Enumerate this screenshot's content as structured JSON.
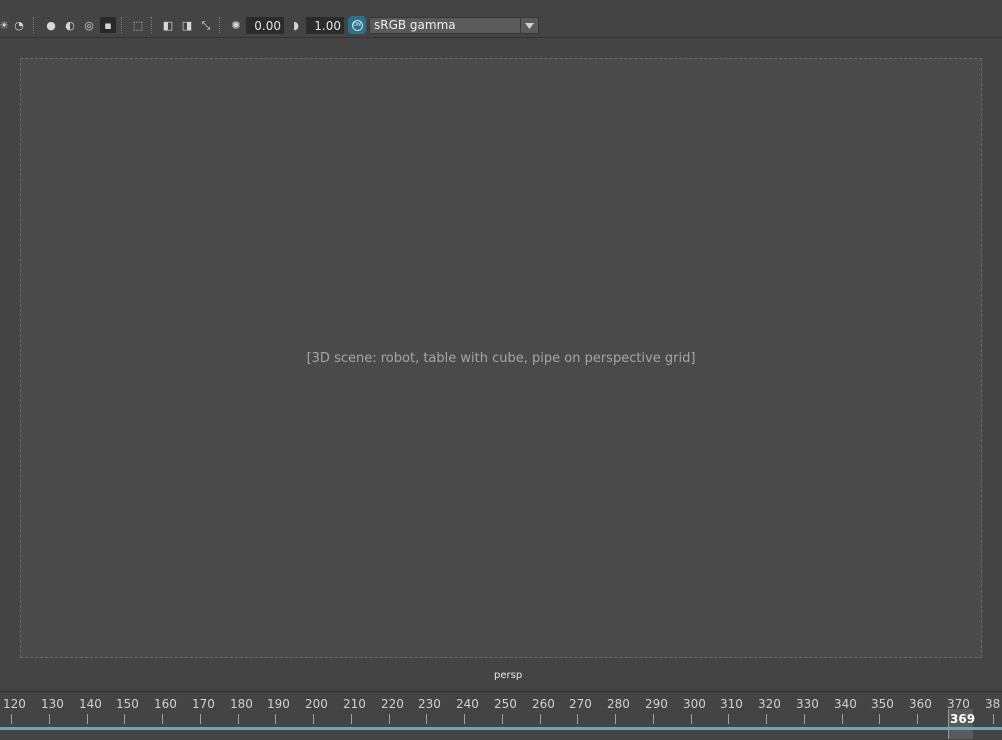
{
  "toolbar": {
    "icons": [
      "light-bulb-icon",
      "lights-icon",
      "shadow-icon",
      "shaded-sphere-icon",
      "ambient-occlusion-icon",
      "motion-blur-icon",
      "antialias-icon",
      "isolate-select-icon",
      "xray-icon",
      "xray-joints-icon",
      "resolution-gate-icon",
      "exposure-icon",
      "gamma-icon"
    ],
    "exposure_value": "0.00",
    "gamma_value": "1.00",
    "color_management_icon": "color-management-on-icon",
    "color_space": "sRGB gamma"
  },
  "viewport": {
    "camera_label": "persp"
  },
  "timeline": {
    "ticks": [
      "120",
      "130",
      "140",
      "150",
      "160",
      "170",
      "180",
      "190",
      "200",
      "210",
      "220",
      "230",
      "240",
      "250",
      "260",
      "270",
      "280",
      "290",
      "300",
      "310",
      "320",
      "330",
      "340",
      "350",
      "360",
      "370",
      "38"
    ],
    "current_frame": "369",
    "accent_color": "#5fa8c8"
  },
  "colors": {
    "background": "#444444",
    "field_background": "#2b2b2b",
    "toggle_on": "#2f6f88"
  }
}
